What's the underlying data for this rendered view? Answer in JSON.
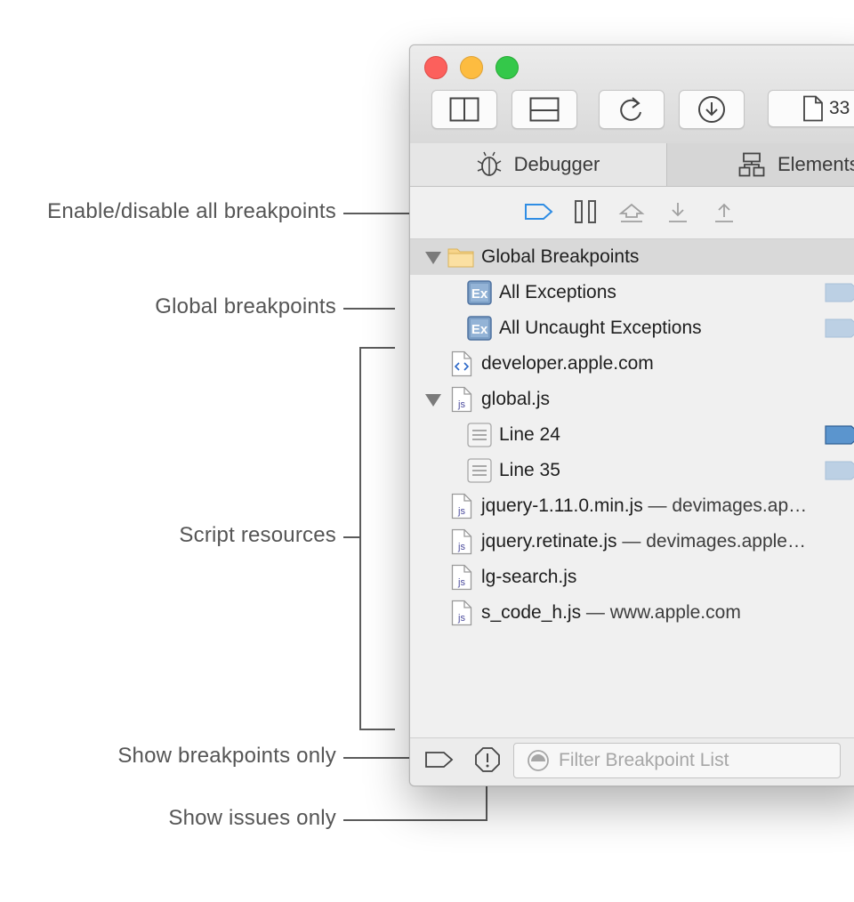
{
  "callouts": {
    "enable_disable": "Enable/disable all breakpoints",
    "global_breakpoints": "Global breakpoints",
    "script_resources": "Script resources",
    "show_breakpoints_only": "Show breakpoints only",
    "show_issues_only": "Show issues only"
  },
  "toolbar": {
    "page_count_label": "33"
  },
  "tabs": [
    {
      "label": "Debugger",
      "icon": "bug-icon"
    },
    {
      "label": "Elements",
      "icon": "elements-tree-icon"
    }
  ],
  "breakpoint_toolbar": {
    "icons": [
      "breakpoint-toggle-icon",
      "pause-icon",
      "step-over-icon",
      "step-into-icon",
      "step-out-icon"
    ]
  },
  "list": {
    "global_breakpoints_label": "Global Breakpoints",
    "all_exceptions": "All Exceptions",
    "all_uncaught_exceptions": "All Uncaught Exceptions",
    "developer_apple": "developer.apple.com",
    "global_js": "global.js",
    "line_24": "Line 24",
    "line_35": "Line 35",
    "jquery_min": "jquery-1.11.0.min.js",
    "jquery_min_domain": "— devimages.ap…",
    "jquery_retinate": "jquery.retinate.js",
    "jquery_retinate_domain": "— devimages.apple…",
    "lg_search": "lg-search.js",
    "s_code": "s_code_h.js",
    "s_code_domain": "— www.apple.com"
  },
  "filter": {
    "placeholder": "Filter Breakpoint List"
  },
  "colors": {
    "breakpoint_active": "#5b95ce",
    "breakpoint_inactive": "#bcd0e4",
    "accent": "#2f8de4"
  }
}
